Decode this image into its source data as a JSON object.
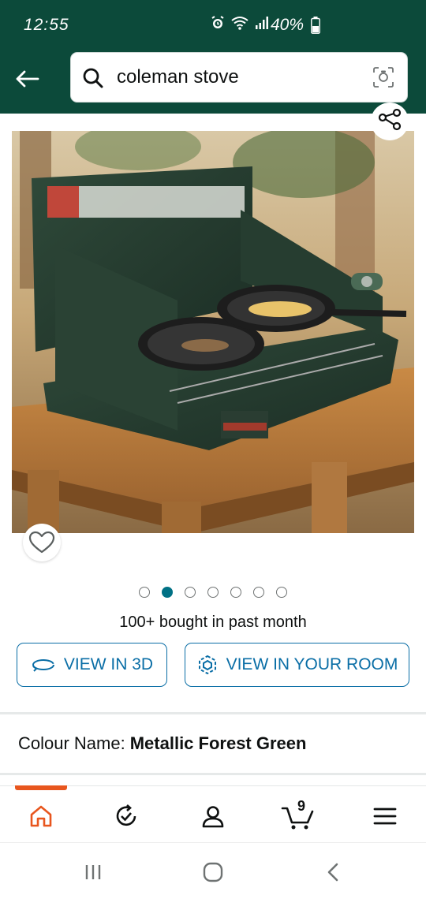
{
  "status_bar": {
    "time": "12:55",
    "battery": "40%",
    "icons": [
      "alarm-icon",
      "wifi-icon",
      "signal-icon",
      "battery-icon"
    ]
  },
  "search": {
    "query": "coleman stove",
    "icons": [
      "back-arrow-icon",
      "search-icon",
      "camera-icon"
    ]
  },
  "product": {
    "image_alt": "Coleman propane camp stove with two cast iron pans on a picnic table",
    "image_count": 7,
    "active_image_index": 1,
    "bought_text": "100+ bought in past month",
    "view_3d_label": "VIEW IN 3D",
    "view_room_label": "VIEW IN YOUR ROOM",
    "colour_label": "Colour Name:",
    "colour_value": "Metallic Forest Green"
  },
  "bottom_nav": {
    "items": [
      "home-icon",
      "recent-icon",
      "account-icon",
      "cart-icon",
      "menu-icon"
    ],
    "active": "home-icon",
    "cart_count": "9"
  },
  "colors": {
    "header": "#0c4a3a",
    "link": "#0a6ea6",
    "accent": "#e8561e",
    "dot_active": "#007185"
  }
}
